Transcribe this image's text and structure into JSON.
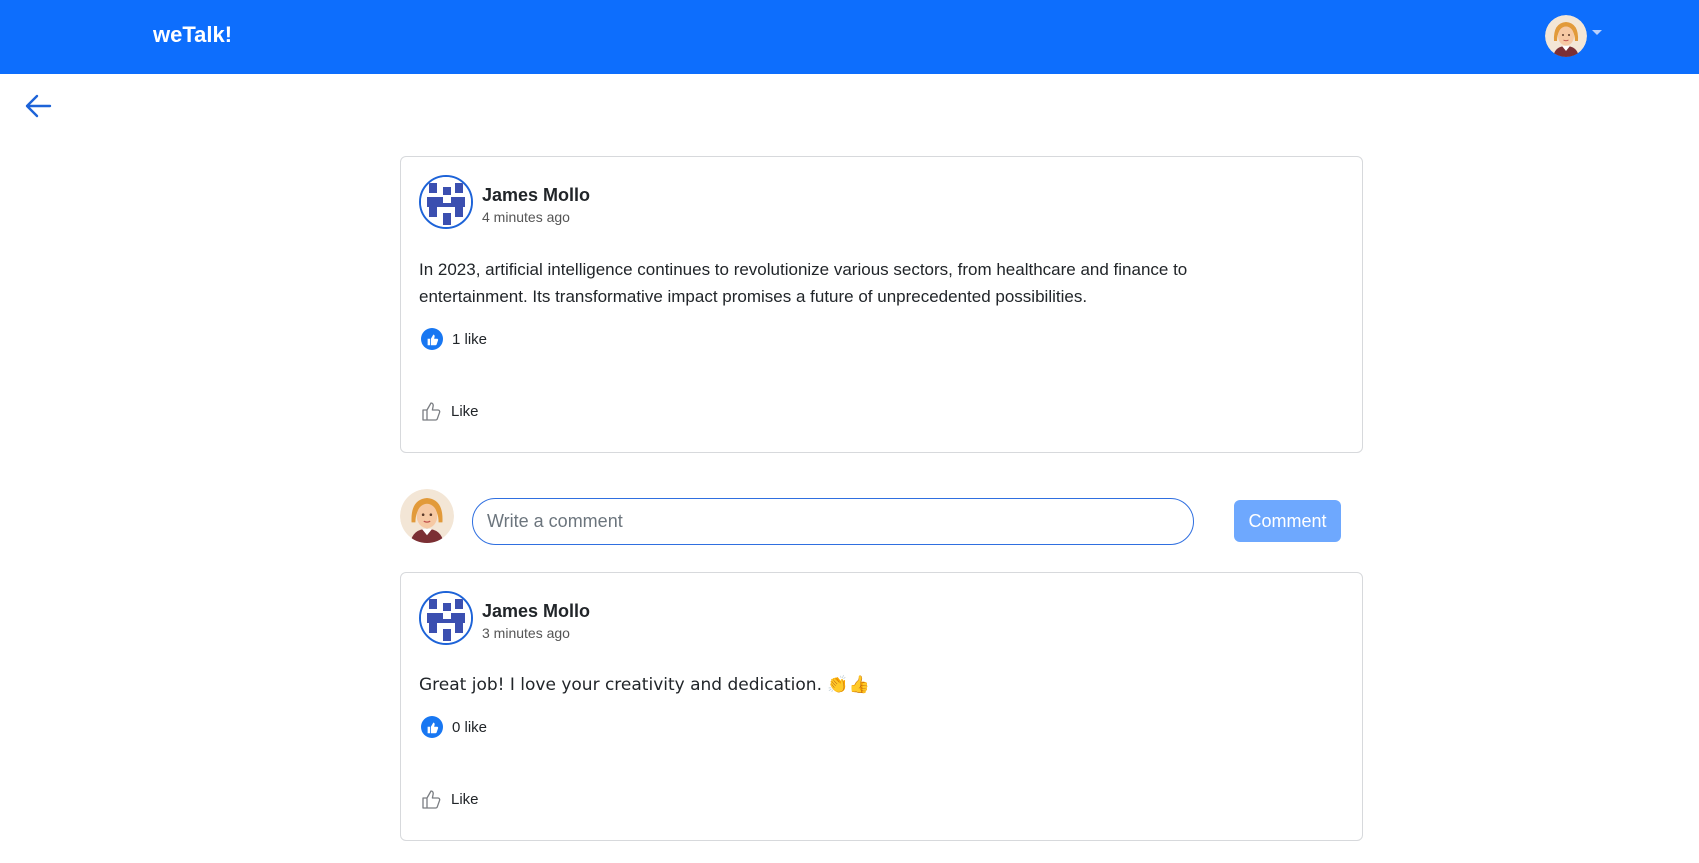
{
  "app": {
    "brand": "weTalk!"
  },
  "colors": {
    "primary": "#0d6efd",
    "like_blue": "#1877f2",
    "comment_button": "#6ea8fe"
  },
  "icons": {
    "back": "arrow-left-icon",
    "like_filled": "thumbs-up-filled-icon",
    "like_outline": "thumbs-up-outline-icon",
    "caret": "caret-down-icon"
  },
  "post": {
    "author": "James Mollo",
    "time": "4 minutes ago",
    "text": "In 2023, artificial intelligence continues to revolutionize various sectors, from healthcare and finance to entertainment. Its transformative impact promises a future of unprecedented possibilities.",
    "likes": "1 like",
    "like_label": "Like"
  },
  "comment_form": {
    "placeholder": "Write a comment",
    "button_label": "Comment"
  },
  "comments": [
    {
      "author": "James Mollo",
      "time": "3 minutes ago",
      "text": "Great job! I love your creativity and dedication. 👏👍",
      "likes": "0 like",
      "like_label": "Like"
    }
  ]
}
